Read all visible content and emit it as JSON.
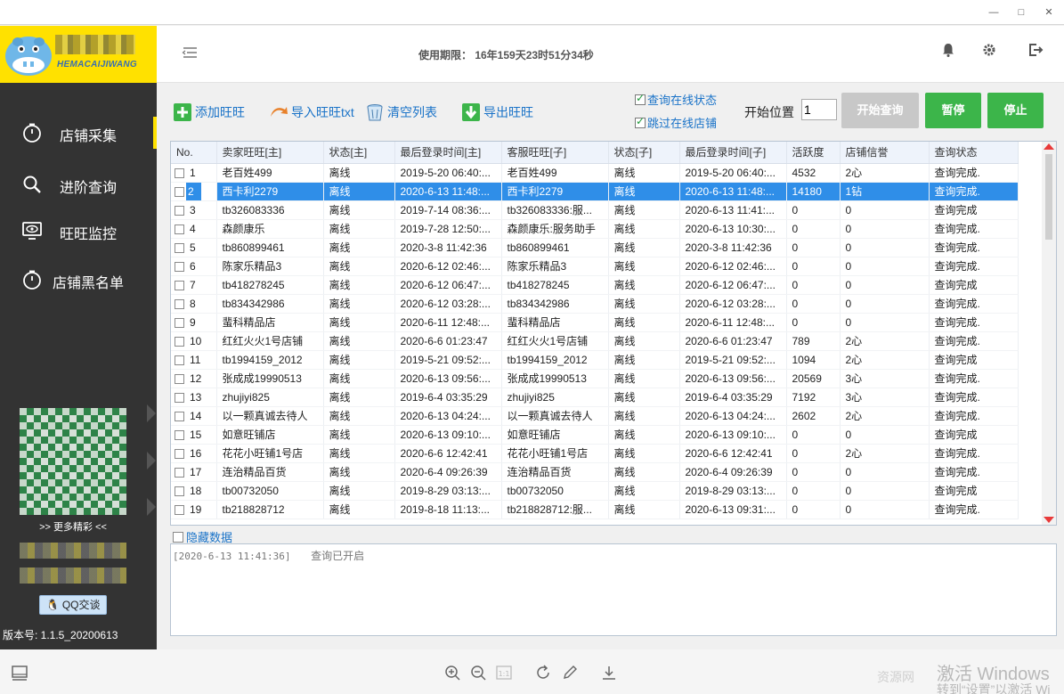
{
  "window": {
    "minimize": "—",
    "maximize": "□",
    "close": "✕"
  },
  "brand": {
    "name": "HEMACAIJIWANG"
  },
  "header": {
    "usage_text": "使用期限：  16年159天23时51分34秒"
  },
  "sidebar": {
    "items": [
      {
        "label": "店铺采集",
        "icon": "clock-icon",
        "active": true
      },
      {
        "label": "进阶查询",
        "icon": "search-icon",
        "active": false
      },
      {
        "label": "旺旺监控",
        "icon": "monitor-icon",
        "active": false
      },
      {
        "label": "店铺黑名单",
        "icon": "clock-icon",
        "active": false
      }
    ],
    "more_label": ">> 更多精彩 <<",
    "qq_label": "QQ交谈",
    "version": "版本号: 1.1.5_20200613"
  },
  "toolbar": {
    "add_label": "添加旺旺",
    "import_label": "导入旺旺txt",
    "clear_label": "清空列表",
    "export_label": "导出旺旺",
    "check_online_label": "查询在线状态",
    "skip_online_label": "跳过在线店铺",
    "start_pos_label": "开始位置",
    "start_pos_value": "1",
    "start_query_label": "开始查询",
    "pause_label": "暂停",
    "stop_label": "停止"
  },
  "table": {
    "columns": [
      "No.",
      "卖家旺旺[主]",
      "状态[主]",
      "最后登录时间[主]",
      "客服旺旺[子]",
      "状态[子]",
      "最后登录时间[子]",
      "活跃度",
      "店铺信誉",
      "查询状态"
    ],
    "rows": [
      [
        "1",
        "老百姓499",
        "离线",
        "2019-5-20 06:40:...",
        "老百姓499",
        "离线",
        "2019-5-20 06:40:...",
        "4532",
        "2心",
        "查询完成."
      ],
      [
        "2",
        "西卡利2279",
        "离线",
        "2020-6-13 11:48:...",
        "西卡利2279",
        "离线",
        "2020-6-13 11:48:...",
        "14180",
        "1钻",
        "查询完成."
      ],
      [
        "3",
        "tb326083336",
        "离线",
        "2019-7-14 08:36:...",
        "tb326083336:服...",
        "离线",
        "2020-6-13 11:41:...",
        "0",
        "0",
        "查询完成"
      ],
      [
        "4",
        "森颜康乐",
        "离线",
        "2019-7-28 12:50:...",
        "森颜康乐:服务助手",
        "离线",
        "2020-6-13 10:30:...",
        "0",
        "0",
        "查询完成."
      ],
      [
        "5",
        "tb860899461",
        "离线",
        "2020-3-8 11:42:36",
        "tb860899461",
        "离线",
        "2020-3-8 11:42:36",
        "0",
        "0",
        "查询完成."
      ],
      [
        "6",
        "陈家乐精品3",
        "离线",
        "2020-6-12 02:46:...",
        "陈家乐精品3",
        "离线",
        "2020-6-12 02:46:...",
        "0",
        "0",
        "查询完成."
      ],
      [
        "7",
        "tb418278245",
        "离线",
        "2020-6-12 06:47:...",
        "tb418278245",
        "离线",
        "2020-6-12 06:47:...",
        "0",
        "0",
        "查询完成"
      ],
      [
        "8",
        "tb834342986",
        "离线",
        "2020-6-12 03:28:...",
        "tb834342986",
        "离线",
        "2020-6-12 03:28:...",
        "0",
        "0",
        "查询完成."
      ],
      [
        "9",
        "蜚科精品店",
        "离线",
        "2020-6-11 12:48:...",
        "蜚科精品店",
        "离线",
        "2020-6-11 12:48:...",
        "0",
        "0",
        "查询完成."
      ],
      [
        "10",
        "红红火火1号店铺",
        "离线",
        "2020-6-6 01:23:47",
        "红红火火1号店铺",
        "离线",
        "2020-6-6 01:23:47",
        "789",
        "2心",
        "查询完成."
      ],
      [
        "11",
        "tb1994159_2012",
        "离线",
        "2019-5-21 09:52:...",
        "tb1994159_2012",
        "离线",
        "2019-5-21 09:52:...",
        "1094",
        "2心",
        "查询完成"
      ],
      [
        "12",
        "张成成19990513",
        "离线",
        "2020-6-13 09:56:...",
        "张成成19990513",
        "离线",
        "2020-6-13 09:56:...",
        "20569",
        "3心",
        "查询完成."
      ],
      [
        "13",
        "zhujiyi825",
        "离线",
        "2019-6-4 03:35:29",
        "zhujiyi825",
        "离线",
        "2019-6-4 03:35:29",
        "7192",
        "3心",
        "查询完成."
      ],
      [
        "14",
        "以一颗真诚去待人",
        "离线",
        "2020-6-13 04:24:...",
        "以一颗真诚去待人",
        "离线",
        "2020-6-13 04:24:...",
        "2602",
        "2心",
        "查询完成."
      ],
      [
        "15",
        "如意旺铺店",
        "离线",
        "2020-6-13 09:10:...",
        "如意旺铺店",
        "离线",
        "2020-6-13 09:10:...",
        "0",
        "0",
        "查询完成"
      ],
      [
        "16",
        "花花小旺铺1号店",
        "离线",
        "2020-6-6 12:42:41",
        "花花小旺铺1号店",
        "离线",
        "2020-6-6 12:42:41",
        "0",
        "2心",
        "查询完成."
      ],
      [
        "17",
        "连治精品百货",
        "离线",
        "2020-6-4 09:26:39",
        "连治精品百货",
        "离线",
        "2020-6-4 09:26:39",
        "0",
        "0",
        "查询完成."
      ],
      [
        "18",
        "tb00732050",
        "离线",
        "2019-8-29 03:13:...",
        "tb00732050",
        "离线",
        "2019-8-29 03:13:...",
        "0",
        "0",
        "查询完成"
      ],
      [
        "19",
        "tb218828712",
        "离线",
        "2019-8-18 11:13:...",
        "tb218828712:服...",
        "离线",
        "2020-6-13 09:31:...",
        "0",
        "0",
        "查询完成."
      ]
    ]
  },
  "hide_data_label": "隐藏数据",
  "log": {
    "timestamp": "[2020-6-13 11:41:36]",
    "message": "查询已开启"
  },
  "watermark": {
    "line1": "激活 Windows",
    "line2": "转到“设置”以激活 Wi",
    "left": "资源网"
  },
  "colors": {
    "sidebar": "#333333",
    "accent": "#ffe100",
    "green": "#3cb54a",
    "selected": "#2f8ee8",
    "link": "#1a73c8"
  }
}
